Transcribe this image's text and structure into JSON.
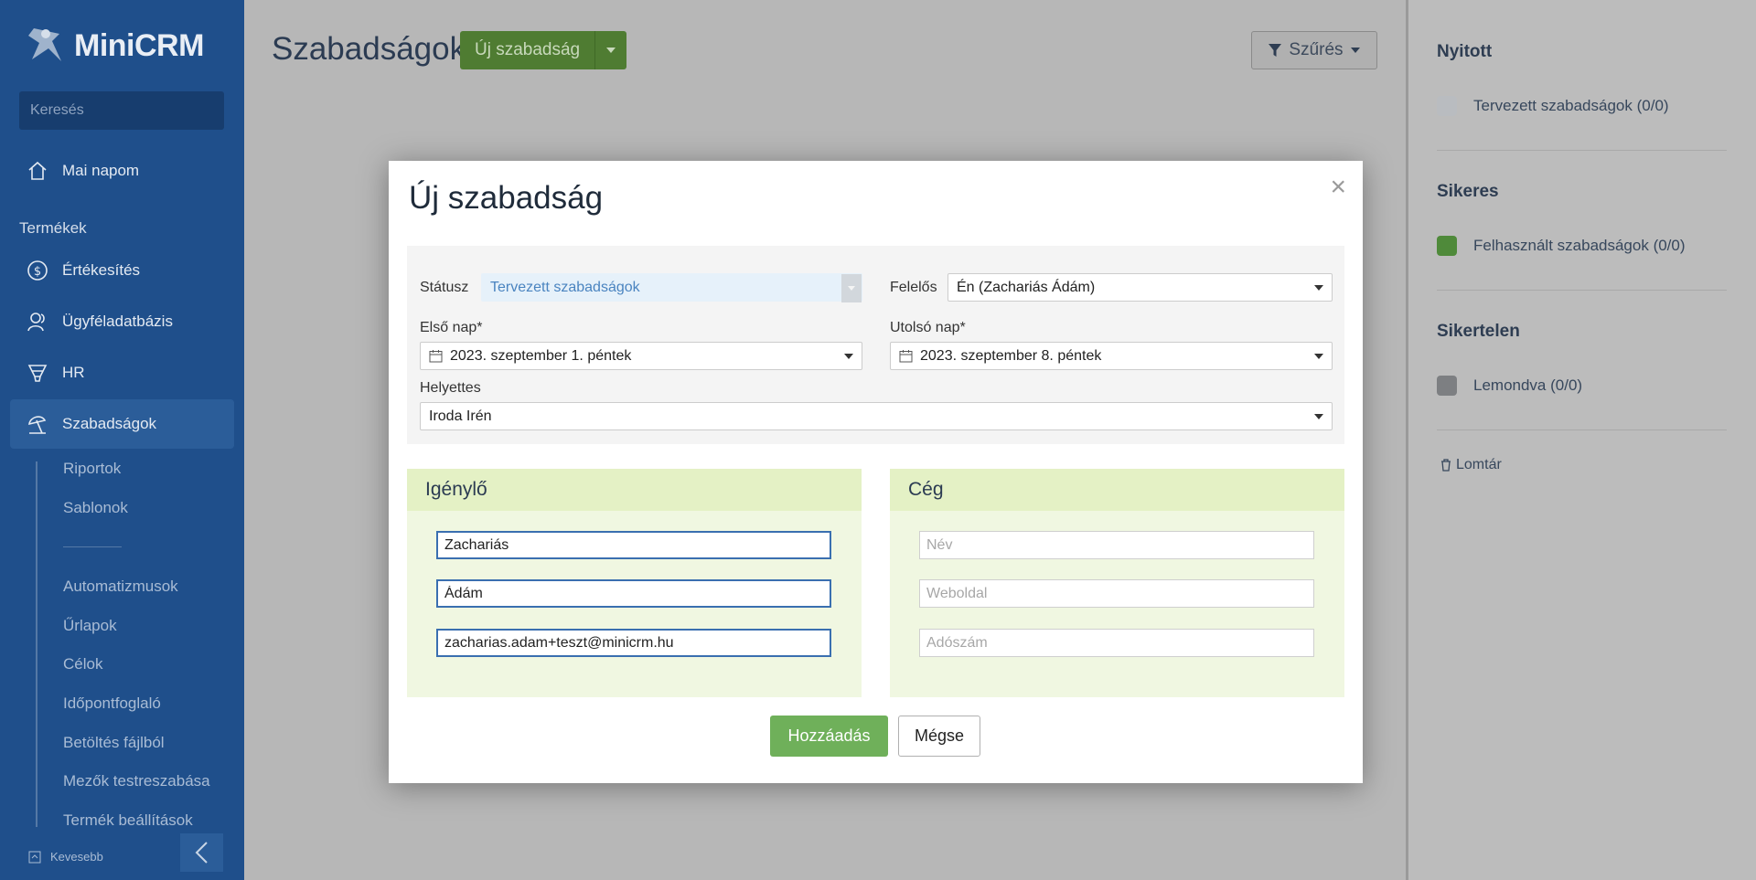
{
  "app": {
    "name": "MiniCRM"
  },
  "sidebar": {
    "search_placeholder": "Keresés",
    "home": "Mai napom",
    "section_label": "Termékek",
    "items": [
      {
        "label": "Értékesítés",
        "icon": "dollar-circle-icon"
      },
      {
        "label": "Ügyféladatbázis",
        "icon": "contacts-icon"
      },
      {
        "label": "HR",
        "icon": "funnel-icon"
      },
      {
        "label": "Szabadságok",
        "icon": "beach-umbrella-icon",
        "active": true
      }
    ],
    "sub_items": [
      "Riportok",
      "Sablonok",
      "Automatizmusok",
      "Űrlapok",
      "Célok",
      "Időpontfoglaló",
      "Betöltés fájlból",
      "Mezők testreszabása",
      "Termék beállítások"
    ],
    "footer_less": "Kevesebb"
  },
  "header": {
    "title": "Szabadságok",
    "new_button": "Új szabadság",
    "filter_button": "Szűrés"
  },
  "right_panel": {
    "groups": [
      {
        "title": "Nyitott",
        "item": "Tervezett szabadságok (0/0)",
        "color": "#b9bcc0"
      },
      {
        "title": "Sikeres",
        "item": "Felhasznált szabadságok (0/0)",
        "color": "#4f8a3a"
      },
      {
        "title": "Sikertelen",
        "item": "Lemondva (0/0)",
        "color": "#7d7f82"
      }
    ],
    "trash": "Lomtár"
  },
  "modal": {
    "title": "Új szabadság",
    "status_label": "Státusz",
    "status_value": "Tervezett szabadságok",
    "owner_label": "Felelős",
    "owner_value": "Én (Zachariás Ádám)",
    "first_day_label": "Első nap*",
    "first_day_value": "2023. szeptember 1. péntek",
    "last_day_label": "Utolsó nap*",
    "last_day_value": "2023. szeptember 8. péntek",
    "substitute_label": "Helyettes",
    "substitute_value": "Iroda Irén",
    "requester": {
      "title": "Igénylő",
      "last_name": "Zachariás",
      "first_name": "Ádám",
      "email": "zacharias.adam+teszt@minicrm.hu"
    },
    "company": {
      "title": "Cég",
      "name_placeholder": "Név",
      "website_placeholder": "Weboldal",
      "tax_placeholder": "Adószám"
    },
    "add_button": "Hozzáadás",
    "cancel_button": "Mégse"
  }
}
